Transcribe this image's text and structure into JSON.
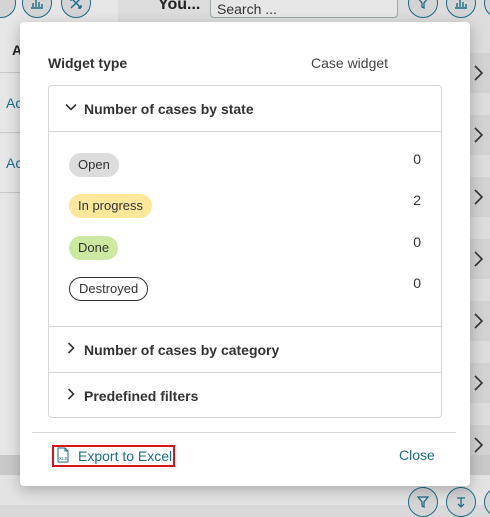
{
  "background": {
    "title": "You...",
    "search_placeholder": "Search ...",
    "column_header": "A",
    "row_links": [
      "Ac",
      "Ac"
    ]
  },
  "dialog": {
    "widget_type_label": "Widget type",
    "widget_type_value": "Case widget",
    "sections": [
      {
        "title": "Number of cases by state",
        "expanded": true
      },
      {
        "title": "Number of cases by category",
        "expanded": false
      },
      {
        "title": "Predefined filters",
        "expanded": false
      }
    ],
    "states": [
      {
        "label": "Open",
        "count": "0",
        "color": "#dcdcdc"
      },
      {
        "label": "In progress",
        "count": "2",
        "color": "#fde79a"
      },
      {
        "label": "Done",
        "count": "0",
        "color": "#cde8a0"
      },
      {
        "label": "Destroyed",
        "count": "0",
        "color": "#ffffff"
      }
    ],
    "export_label": "Export to Excel",
    "close_label": "Close"
  },
  "colors": {
    "link": "#1b6d86",
    "focus_outline": "#d7141a"
  }
}
